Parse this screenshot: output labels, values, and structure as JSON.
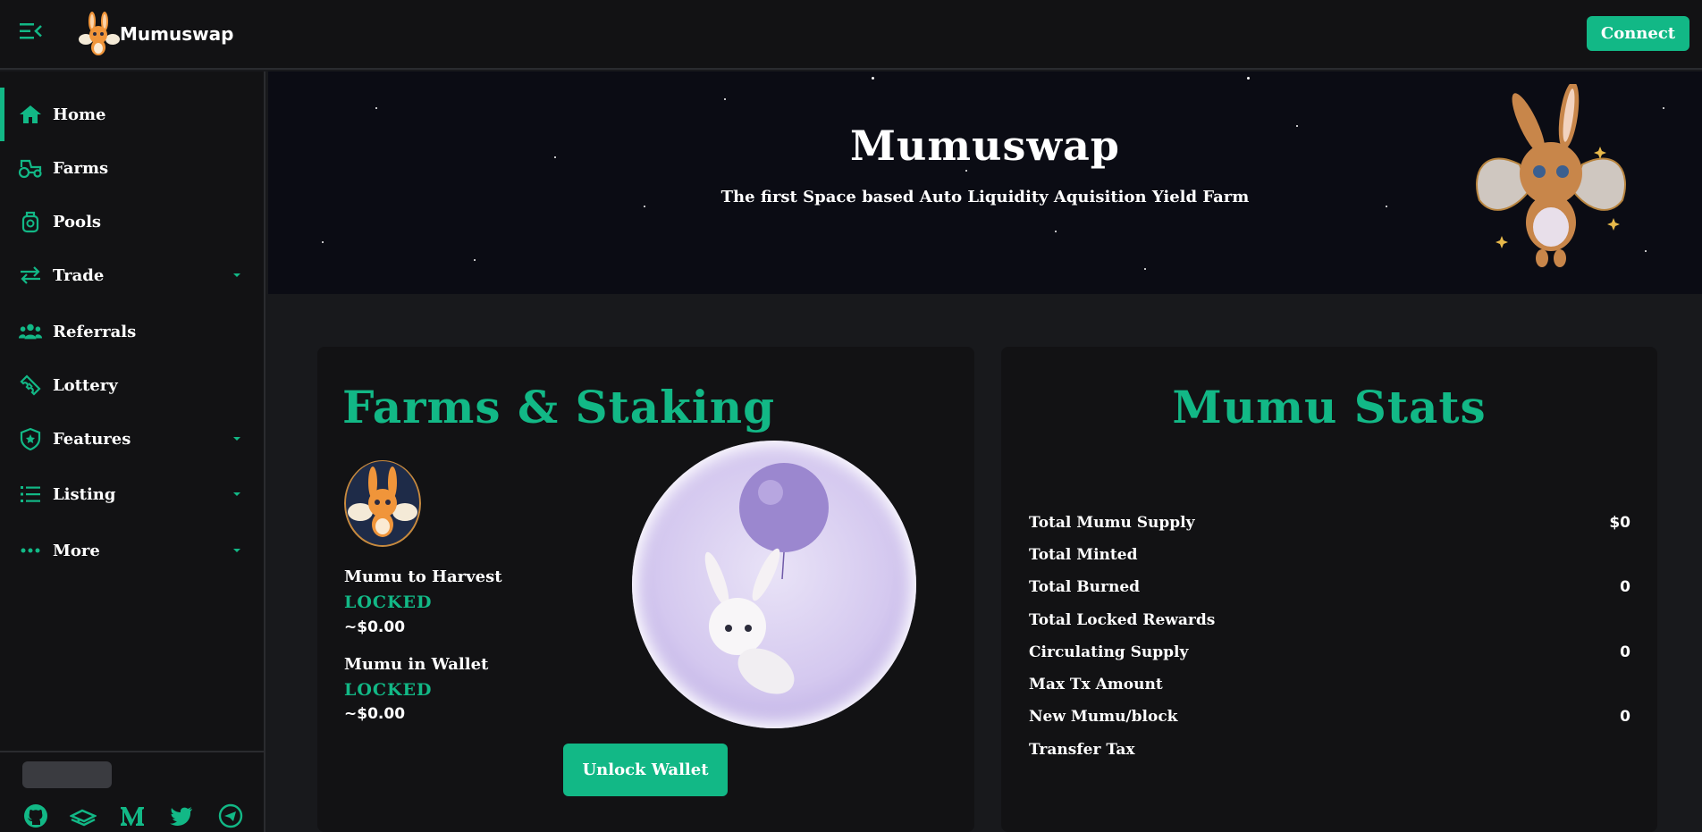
{
  "app": {
    "name": "Mumuswap",
    "connect_label": "Connect",
    "accent_color": "#12b886"
  },
  "sidebar": {
    "items": [
      {
        "label": "Home",
        "icon": "home-icon",
        "active": true,
        "has_caret": false
      },
      {
        "label": "Farms",
        "icon": "tractor-icon",
        "active": false,
        "has_caret": false
      },
      {
        "label": "Pools",
        "icon": "pool-icon",
        "active": false,
        "has_caret": false
      },
      {
        "label": "Trade",
        "icon": "swap-arrows-icon",
        "active": false,
        "has_caret": true
      },
      {
        "label": "Referrals",
        "icon": "users-icon",
        "active": false,
        "has_caret": false
      },
      {
        "label": "Lottery",
        "icon": "ticket-icon",
        "active": false,
        "has_caret": false
      },
      {
        "label": "Features",
        "icon": "shield-star-icon",
        "active": false,
        "has_caret": true
      },
      {
        "label": "Listing",
        "icon": "list-icon",
        "active": false,
        "has_caret": true
      },
      {
        "label": "More",
        "icon": "dots-icon",
        "active": false,
        "has_caret": true
      }
    ],
    "socials": [
      "github-icon",
      "gitbook-icon",
      "medium-icon",
      "twitter-icon",
      "telegram-icon"
    ]
  },
  "banner": {
    "title": "Mumuswap",
    "subtitle": "The first Space based Auto Liquidity Aquisition Yield Farm"
  },
  "farms_card": {
    "title": "Farms & Staking",
    "harvest_label": "Mumu to Harvest",
    "harvest_status": "LOCKED",
    "harvest_value": "~$0.00",
    "wallet_label": "Mumu in Wallet",
    "wallet_status": "LOCKED",
    "wallet_value": "~$0.00",
    "unlock_label": "Unlock Wallet"
  },
  "stats_card": {
    "title": "Mumu Stats",
    "rows": [
      {
        "label": "Total Mumu Supply",
        "value": "$0"
      },
      {
        "label": "Total Minted",
        "value": ""
      },
      {
        "label": "Total Burned",
        "value": "0"
      },
      {
        "label": "Total Locked Rewards",
        "value": ""
      },
      {
        "label": "Circulating Supply",
        "value": "0"
      },
      {
        "label": "Max Tx Amount",
        "value": ""
      },
      {
        "label": "New Mumu/block",
        "value": "0"
      },
      {
        "label": "Transfer Tax",
        "value": ""
      }
    ]
  }
}
